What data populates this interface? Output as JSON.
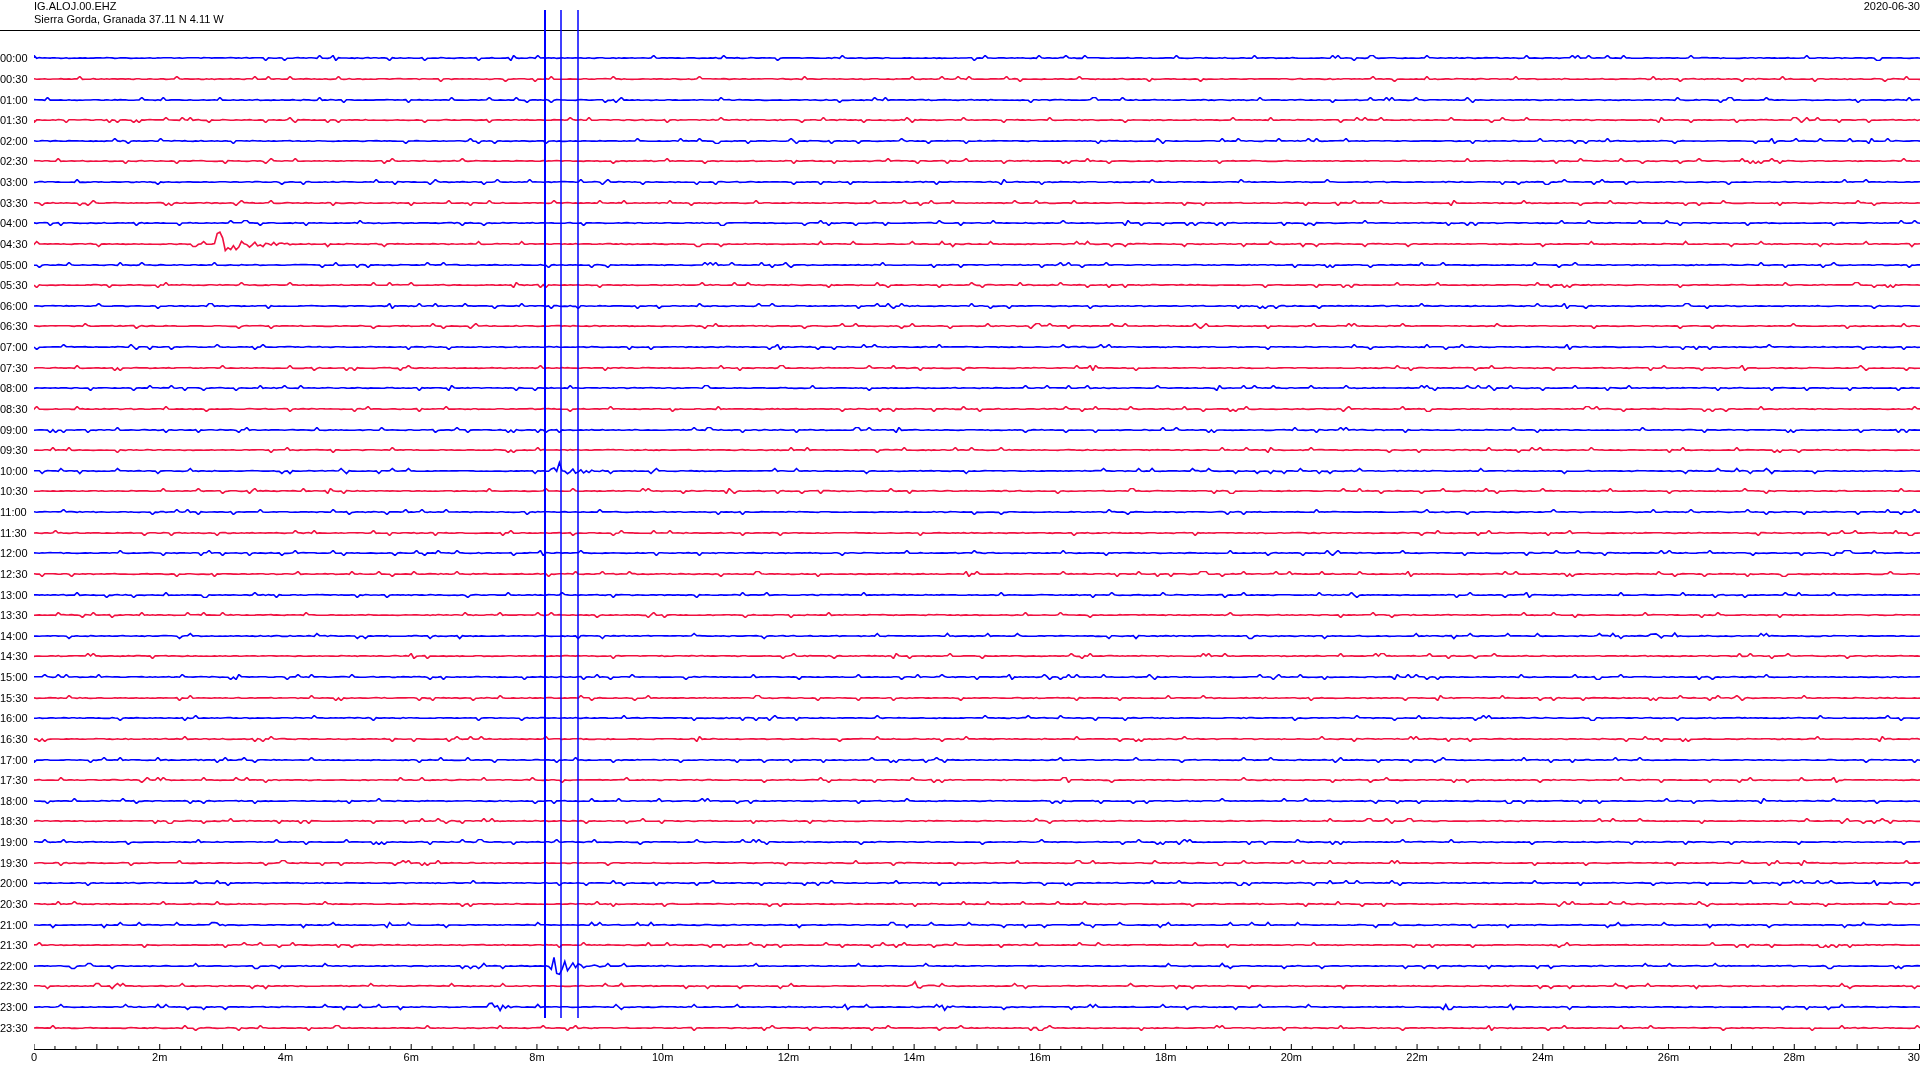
{
  "header": {
    "station": "IG.ALOJ.00.EHZ",
    "location": "Sierra Gorda, Granada  37.11 N 4.11 W",
    "date": "2020-06-30"
  },
  "rows": [
    {
      "time": "00:00",
      "color": "#0000ff"
    },
    {
      "time": "00:30",
      "color": "#f01040"
    },
    {
      "time": "01:00",
      "color": "#0000ff"
    },
    {
      "time": "01:30",
      "color": "#f01040"
    },
    {
      "time": "02:00",
      "color": "#0000ff"
    },
    {
      "time": "02:30",
      "color": "#f01040"
    },
    {
      "time": "03:00",
      "color": "#0000ff"
    },
    {
      "time": "03:30",
      "color": "#f01040"
    },
    {
      "time": "04:00",
      "color": "#0000ff"
    },
    {
      "time": "04:30",
      "color": "#f01040"
    },
    {
      "time": "05:00",
      "color": "#0000ff"
    },
    {
      "time": "05:30",
      "color": "#f01040"
    },
    {
      "time": "06:00",
      "color": "#0000ff"
    },
    {
      "time": "06:30",
      "color": "#f01040"
    },
    {
      "time": "07:00",
      "color": "#0000ff"
    },
    {
      "time": "07:30",
      "color": "#f01040"
    },
    {
      "time": "08:00",
      "color": "#0000ff"
    },
    {
      "time": "08:30",
      "color": "#f01040"
    },
    {
      "time": "09:00",
      "color": "#0000ff"
    },
    {
      "time": "09:30",
      "color": "#f01040"
    },
    {
      "time": "10:00",
      "color": "#0000ff"
    },
    {
      "time": "10:30",
      "color": "#f01040"
    },
    {
      "time": "11:00",
      "color": "#0000ff"
    },
    {
      "time": "11:30",
      "color": "#f01040"
    },
    {
      "time": "12:00",
      "color": "#0000ff"
    },
    {
      "time": "12:30",
      "color": "#f01040"
    },
    {
      "time": "13:00",
      "color": "#0000ff"
    },
    {
      "time": "13:30",
      "color": "#f01040"
    },
    {
      "time": "14:00",
      "color": "#0000ff"
    },
    {
      "time": "14:30",
      "color": "#f01040"
    },
    {
      "time": "15:00",
      "color": "#0000ff"
    },
    {
      "time": "15:30",
      "color": "#f01040"
    },
    {
      "time": "16:00",
      "color": "#0000ff"
    },
    {
      "time": "16:30",
      "color": "#f01040"
    },
    {
      "time": "17:00",
      "color": "#0000ff"
    },
    {
      "time": "17:30",
      "color": "#f01040"
    },
    {
      "time": "18:00",
      "color": "#0000ff"
    },
    {
      "time": "18:30",
      "color": "#f01040"
    },
    {
      "time": "19:00",
      "color": "#0000ff"
    },
    {
      "time": "19:30",
      "color": "#f01040"
    },
    {
      "time": "20:00",
      "color": "#0000ff"
    },
    {
      "time": "20:30",
      "color": "#f01040"
    },
    {
      "time": "21:00",
      "color": "#0000ff"
    },
    {
      "time": "21:30",
      "color": "#f01040"
    },
    {
      "time": "22:00",
      "color": "#0000ff"
    },
    {
      "time": "22:30",
      "color": "#f01040"
    },
    {
      "time": "23:00",
      "color": "#0000ff"
    },
    {
      "time": "23:30",
      "color": "#f01040"
    }
  ],
  "x_axis": {
    "ticks": [
      "0",
      "2m",
      "4m",
      "6m",
      "8m",
      "10m",
      "12m",
      "14m",
      "16m",
      "18m",
      "20m",
      "22m",
      "24m",
      "26m",
      "28m",
      "30"
    ]
  }
}
